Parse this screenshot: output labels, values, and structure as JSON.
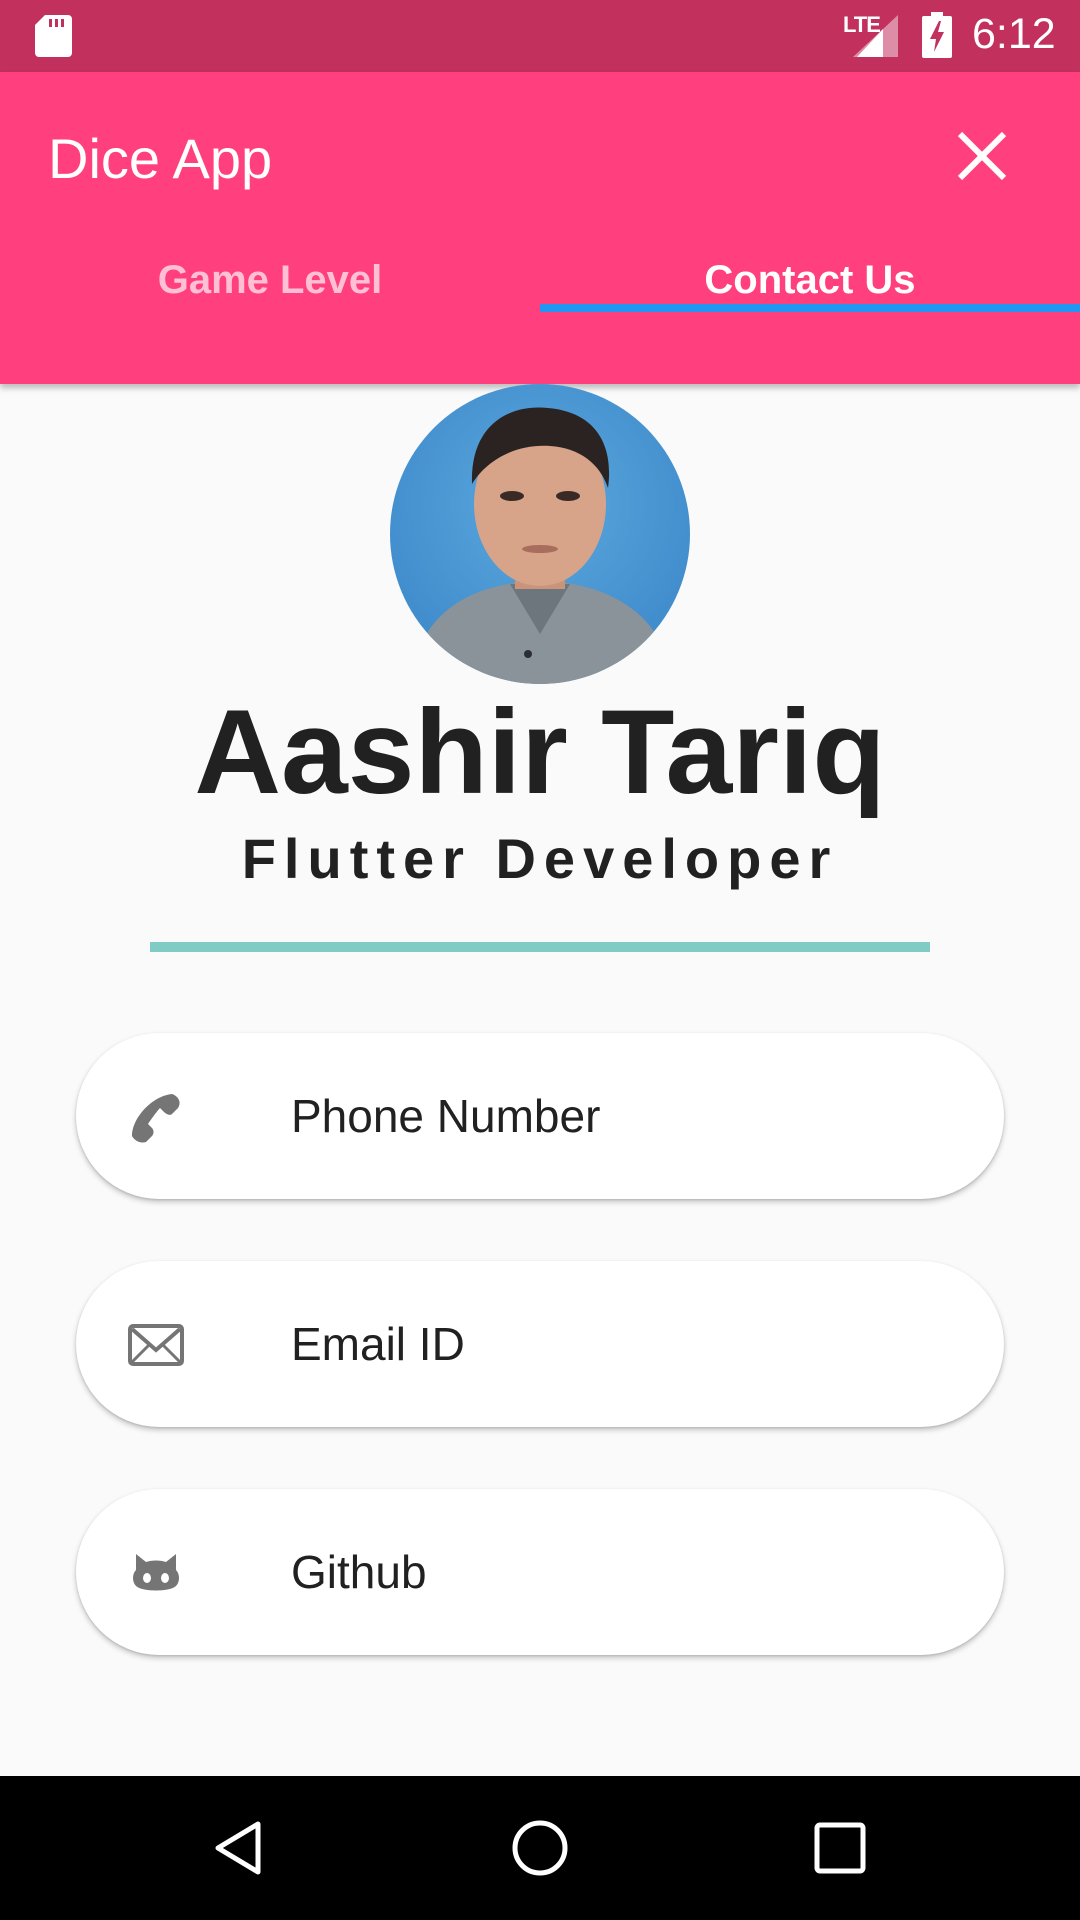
{
  "status_bar": {
    "network_label": "LTE",
    "clock": "6:12",
    "background_color": "#c2305e"
  },
  "app_bar": {
    "title": "Dice App",
    "close_icon": "close-icon",
    "background_color": "#ff3f7e"
  },
  "tabs": [
    {
      "label": "Game Level",
      "selected": false
    },
    {
      "label": "Contact Us",
      "selected": true
    }
  ],
  "profile": {
    "name": "Aashir Tariq",
    "role": "Flutter Developer",
    "divider_color": "#80cbc4"
  },
  "contacts": [
    {
      "label": "Phone Number",
      "icon": "phone-icon"
    },
    {
      "label": "Email ID",
      "icon": "email-icon"
    },
    {
      "label": "Github",
      "icon": "github-icon"
    }
  ],
  "nav_bar": {
    "back_icon": "back-icon",
    "home_icon": "home-icon",
    "recents_icon": "recents-icon"
  }
}
